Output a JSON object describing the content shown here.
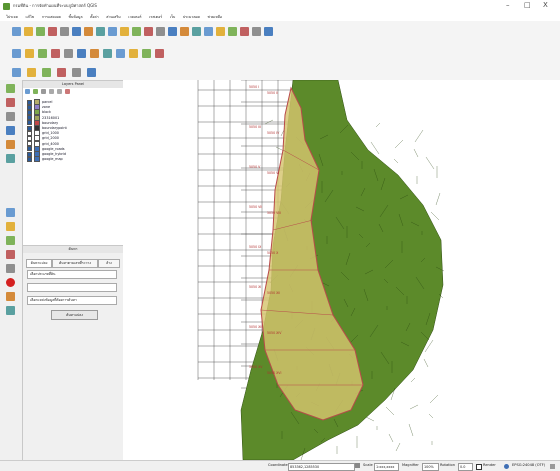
{
  "window": {
    "title": "กรมที่ดิน - การจัดทำแผนที่ระบบภูมิศาสตร์ QGIS",
    "minimize": "–",
    "maximize": "□",
    "close": "X"
  },
  "menu": [
    "โปรเจค",
    "แก้ไข",
    "การแสดงผล",
    "ชั้นข้อมูล",
    "ตั้งค่า",
    "ส่วนเสริม",
    "เวคเตอร์",
    "เรสเตอร์",
    "เว็บ",
    "ประมวลผล",
    "ช่วยเหลือ"
  ],
  "toolbar_icons": {
    "row1": [
      "new-project-icon",
      "open-project-icon",
      "save-project-icon",
      "save-as-icon",
      "print-layout-icon",
      "pan-icon",
      "pan-to-selection-icon",
      "zoom-in-icon",
      "zoom-out-icon",
      "zoom-full-icon",
      "zoom-layer-icon",
      "zoom-selection-icon",
      "zoom-last-icon",
      "zoom-next-icon",
      "refresh-icon",
      "identify-icon",
      "select-icon",
      "deselect-icon",
      "attribute-table-icon",
      "statistics-icon",
      "measure-icon",
      "annotation-icon"
    ],
    "row2": [
      "edit-pencil-icon",
      "digitize-icon",
      "save-edits-icon",
      "add-feature-icon",
      "move-feature-icon",
      "node-tool-icon",
      "delete-icon",
      "cut-icon",
      "copy-icon",
      "paste-icon",
      "undo-icon",
      "redo-icon"
    ],
    "row3": [
      "add-vector-icon",
      "add-raster-icon",
      "add-database-icon",
      "add-wms-icon",
      "style-icon",
      "add-group-icon"
    ]
  },
  "layers_panel": {
    "title": "Layers Panel",
    "layers": [
      {
        "name": "parcel",
        "checked": true,
        "color": "#b5ae6a"
      },
      {
        "name": "zone",
        "checked": true,
        "color": "#8f7fc7"
      },
      {
        "name": "block",
        "checked": true,
        "color": "#7ea84a"
      },
      {
        "name": "23316001",
        "checked": true,
        "color": "#a0a35a"
      },
      {
        "name": "boundary",
        "checked": true,
        "color": "#c04848"
      },
      {
        "name": "boundarypoint",
        "checked": true,
        "color": "#333333"
      },
      {
        "name": "grid_1000",
        "checked": false,
        "color": "#ffffff"
      },
      {
        "name": "grid_2000",
        "checked": false,
        "color": "#ffffff"
      },
      {
        "name": "grid_4000",
        "checked": false,
        "color": "#ffffff"
      },
      {
        "name": "google_roads",
        "checked": true,
        "color": "#3f6fb5"
      },
      {
        "name": "google_hybrid",
        "checked": true,
        "color": "#3f6fb5"
      },
      {
        "name": "google_map",
        "checked": true,
        "color": "#3f6fb5"
      }
    ]
  },
  "search_panel": {
    "title": "ค้นหา",
    "tab1": "ค้นหาแปลง",
    "tab2": "ค้นหาตามเลขที่ระวาง",
    "tab3": "ล้าง",
    "field1_label": "เลือกประเภทที่ดิน",
    "field2_label": "",
    "field3_label": "เลือกแหล่งข้อมูลที่ต้องการค้นหา",
    "button": "ค้นหาแปลง"
  },
  "map_grid_labels": [
    "5050 I",
    "5050 II",
    "5050 III",
    "5050 IV",
    "5050 V",
    "5050 VI",
    "5050 VII",
    "5050 VIII",
    "5050 IX",
    "5050 X",
    "5050 XI",
    "5050 XII",
    "5050 XIII",
    "5050 XIV",
    "5050 XV",
    "5050 XVI"
  ],
  "status": {
    "coordinate_label": "Coordinate",
    "coordinate_value": "853362,1285530",
    "scale_label": "Scale",
    "scale_value": "1:xxx,xxxx",
    "magnifier_label": "Magnifier",
    "magnifier_value": "100%",
    "rotation_label": "Rotation",
    "rotation_value": "0.0",
    "render_label": "Render",
    "crs": "EPSG:24048 (OTF)"
  },
  "colors": {
    "accent_green": "#589632",
    "map_forest": "#5c8a2a",
    "map_highlight": "#d6c46e",
    "boundary": "#b84a4a"
  }
}
